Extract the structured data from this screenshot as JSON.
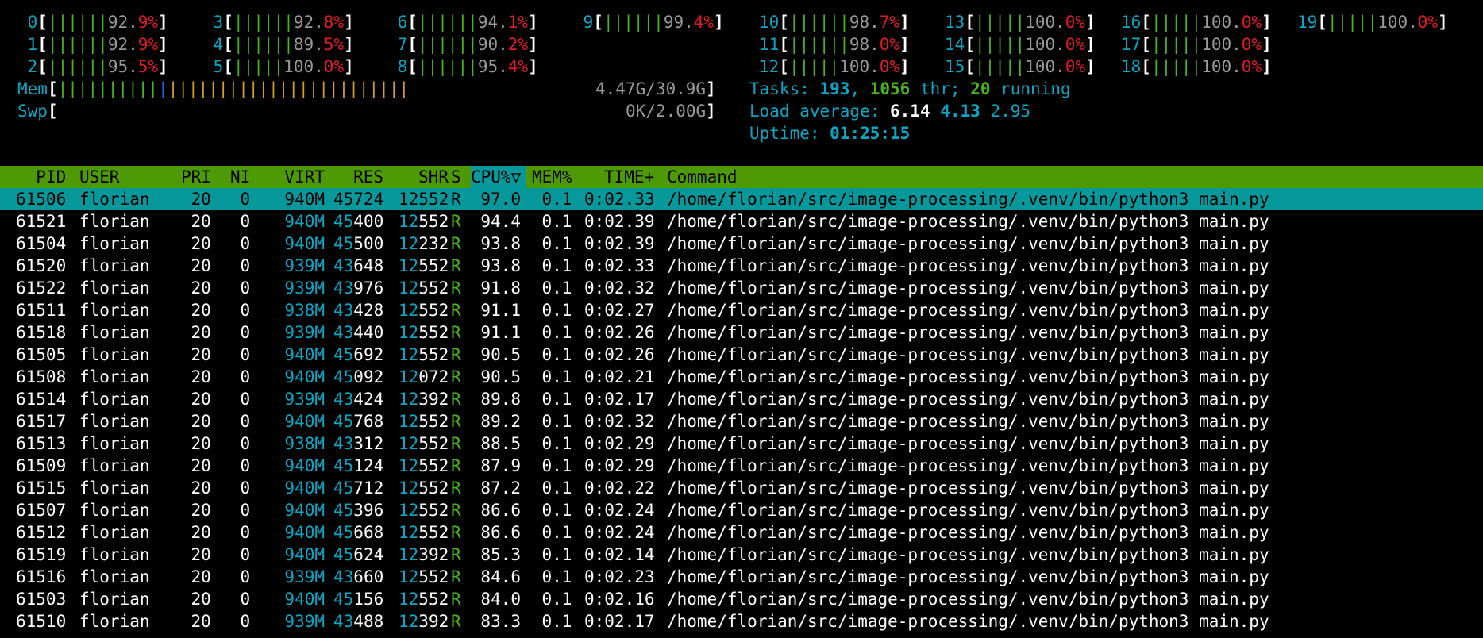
{
  "cpus": [
    {
      "id": "0",
      "bar": "||||||",
      "pct": "92.9",
      "col": 0,
      "row": 0
    },
    {
      "id": "1",
      "bar": "||||||",
      "pct": "92.9",
      "col": 0,
      "row": 1
    },
    {
      "id": "2",
      "bar": "||||||",
      "pct": "95.5",
      "col": 0,
      "row": 2
    },
    {
      "id": "3",
      "bar": "||||||",
      "pct": "92.8",
      "col": 1,
      "row": 0
    },
    {
      "id": "4",
      "bar": "||||||",
      "pct": "89.5",
      "col": 1,
      "row": 1
    },
    {
      "id": "5",
      "bar": "|||||",
      "pct": "100.0",
      "col": 1,
      "row": 2
    },
    {
      "id": "6",
      "bar": "||||||",
      "pct": "94.1",
      "col": 2,
      "row": 0
    },
    {
      "id": "7",
      "bar": "||||||",
      "pct": "90.2",
      "col": 2,
      "row": 1
    },
    {
      "id": "8",
      "bar": "||||||",
      "pct": "95.4",
      "col": 2,
      "row": 2
    },
    {
      "id": "9",
      "bar": "||||||",
      "pct": "99.4",
      "col": 3,
      "row": 0
    },
    {
      "id": "10",
      "bar": "||||||",
      "pct": "98.7",
      "col": 4,
      "row": 0
    },
    {
      "id": "11",
      "bar": "||||||",
      "pct": "98.0",
      "col": 4,
      "row": 1
    },
    {
      "id": "12",
      "bar": "|||||",
      "pct": "100.0",
      "col": 4,
      "row": 2
    },
    {
      "id": "13",
      "bar": "|||||",
      "pct": "100.0",
      "col": 5,
      "row": 0
    },
    {
      "id": "14",
      "bar": "|||||",
      "pct": "100.0",
      "col": 5,
      "row": 1
    },
    {
      "id": "15",
      "bar": "|||||",
      "pct": "100.0",
      "col": 5,
      "row": 2
    },
    {
      "id": "16",
      "bar": "|||||",
      "pct": "100.0",
      "col": 6,
      "row": 0
    },
    {
      "id": "17",
      "bar": "|||||",
      "pct": "100.0",
      "col": 6,
      "row": 1
    },
    {
      "id": "18",
      "bar": "|||||",
      "pct": "100.0",
      "col": 6,
      "row": 2
    },
    {
      "id": "19",
      "bar": "|||||",
      "pct": "100.0",
      "col": 7,
      "row": 0
    }
  ],
  "mem": {
    "label": "Mem",
    "bar_green": "||||||||||",
    "bar_blue": "|",
    "bar_orange": "||||||||||||||||||||||||",
    "value": "4.47G/30.9G"
  },
  "swp": {
    "label": "Swp",
    "value": "0K/2.00G"
  },
  "tasks": {
    "label": "Tasks: ",
    "count": "193",
    "threads": "1056",
    "thr_label": " thr; ",
    "running": "20",
    "running_label": " running"
  },
  "load": {
    "label": "Load average: ",
    "one": "6.14",
    "five": "4.13",
    "fifteen": "2.95"
  },
  "uptime": {
    "label": "Uptime: ",
    "value": "01:25:15"
  },
  "header": {
    "pid": "  PID",
    "user": "USER",
    "pri": "PRI",
    "ni": "NI",
    "virt": "VIRT",
    "res": "RES",
    "shr": "SHR",
    "s": "S",
    "cpu": "CPU%▽",
    "mem": "MEM%",
    "time": "TIME+",
    "command": "Command"
  },
  "colors": {
    "header_bg": "#4e9a06",
    "selected_bg": "#06989a",
    "cyan": "#0aa6c4",
    "green": "#4bb321",
    "red": "#e01b24"
  },
  "processes": [
    {
      "pid": "61506",
      "user": "florian",
      "pri": "20",
      "ni": "0",
      "virt": "940M",
      "res": "45724",
      "shr": "12552",
      "s": "R",
      "cpu": "97.0",
      "mem": "0.1",
      "time": "0:02.33",
      "cmd": "/home/florian/src/image-processing/.venv/bin/python3 main.py"
    },
    {
      "pid": "61521",
      "user": "florian",
      "pri": "20",
      "ni": "0",
      "virt": "940M",
      "res": "45400",
      "shr": "12552",
      "s": "R",
      "cpu": "94.4",
      "mem": "0.1",
      "time": "0:02.39",
      "cmd": "/home/florian/src/image-processing/.venv/bin/python3 main.py"
    },
    {
      "pid": "61504",
      "user": "florian",
      "pri": "20",
      "ni": "0",
      "virt": "940M",
      "res": "45500",
      "shr": "12232",
      "s": "R",
      "cpu": "93.8",
      "mem": "0.1",
      "time": "0:02.39",
      "cmd": "/home/florian/src/image-processing/.venv/bin/python3 main.py"
    },
    {
      "pid": "61520",
      "user": "florian",
      "pri": "20",
      "ni": "0",
      "virt": "939M",
      "res": "43648",
      "shr": "12552",
      "s": "R",
      "cpu": "93.8",
      "mem": "0.1",
      "time": "0:02.33",
      "cmd": "/home/florian/src/image-processing/.venv/bin/python3 main.py"
    },
    {
      "pid": "61522",
      "user": "florian",
      "pri": "20",
      "ni": "0",
      "virt": "939M",
      "res": "43976",
      "shr": "12552",
      "s": "R",
      "cpu": "91.8",
      "mem": "0.1",
      "time": "0:02.32",
      "cmd": "/home/florian/src/image-processing/.venv/bin/python3 main.py"
    },
    {
      "pid": "61511",
      "user": "florian",
      "pri": "20",
      "ni": "0",
      "virt": "938M",
      "res": "43428",
      "shr": "12552",
      "s": "R",
      "cpu": "91.1",
      "mem": "0.1",
      "time": "0:02.27",
      "cmd": "/home/florian/src/image-processing/.venv/bin/python3 main.py"
    },
    {
      "pid": "61518",
      "user": "florian",
      "pri": "20",
      "ni": "0",
      "virt": "939M",
      "res": "43440",
      "shr": "12552",
      "s": "R",
      "cpu": "91.1",
      "mem": "0.1",
      "time": "0:02.26",
      "cmd": "/home/florian/src/image-processing/.venv/bin/python3 main.py"
    },
    {
      "pid": "61505",
      "user": "florian",
      "pri": "20",
      "ni": "0",
      "virt": "940M",
      "res": "45692",
      "shr": "12552",
      "s": "R",
      "cpu": "90.5",
      "mem": "0.1",
      "time": "0:02.26",
      "cmd": "/home/florian/src/image-processing/.venv/bin/python3 main.py"
    },
    {
      "pid": "61508",
      "user": "florian",
      "pri": "20",
      "ni": "0",
      "virt": "940M",
      "res": "45092",
      "shr": "12072",
      "s": "R",
      "cpu": "90.5",
      "mem": "0.1",
      "time": "0:02.21",
      "cmd": "/home/florian/src/image-processing/.venv/bin/python3 main.py"
    },
    {
      "pid": "61514",
      "user": "florian",
      "pri": "20",
      "ni": "0",
      "virt": "939M",
      "res": "43424",
      "shr": "12392",
      "s": "R",
      "cpu": "89.8",
      "mem": "0.1",
      "time": "0:02.17",
      "cmd": "/home/florian/src/image-processing/.venv/bin/python3 main.py"
    },
    {
      "pid": "61517",
      "user": "florian",
      "pri": "20",
      "ni": "0",
      "virt": "940M",
      "res": "45768",
      "shr": "12552",
      "s": "R",
      "cpu": "89.2",
      "mem": "0.1",
      "time": "0:02.32",
      "cmd": "/home/florian/src/image-processing/.venv/bin/python3 main.py"
    },
    {
      "pid": "61513",
      "user": "florian",
      "pri": "20",
      "ni": "0",
      "virt": "938M",
      "res": "43312",
      "shr": "12552",
      "s": "R",
      "cpu": "88.5",
      "mem": "0.1",
      "time": "0:02.29",
      "cmd": "/home/florian/src/image-processing/.venv/bin/python3 main.py"
    },
    {
      "pid": "61509",
      "user": "florian",
      "pri": "20",
      "ni": "0",
      "virt": "940M",
      "res": "45124",
      "shr": "12552",
      "s": "R",
      "cpu": "87.9",
      "mem": "0.1",
      "time": "0:02.29",
      "cmd": "/home/florian/src/image-processing/.venv/bin/python3 main.py"
    },
    {
      "pid": "61515",
      "user": "florian",
      "pri": "20",
      "ni": "0",
      "virt": "940M",
      "res": "45712",
      "shr": "12552",
      "s": "R",
      "cpu": "87.2",
      "mem": "0.1",
      "time": "0:02.22",
      "cmd": "/home/florian/src/image-processing/.venv/bin/python3 main.py"
    },
    {
      "pid": "61507",
      "user": "florian",
      "pri": "20",
      "ni": "0",
      "virt": "940M",
      "res": "45396",
      "shr": "12552",
      "s": "R",
      "cpu": "86.6",
      "mem": "0.1",
      "time": "0:02.24",
      "cmd": "/home/florian/src/image-processing/.venv/bin/python3 main.py"
    },
    {
      "pid": "61512",
      "user": "florian",
      "pri": "20",
      "ni": "0",
      "virt": "940M",
      "res": "45668",
      "shr": "12552",
      "s": "R",
      "cpu": "86.6",
      "mem": "0.1",
      "time": "0:02.24",
      "cmd": "/home/florian/src/image-processing/.venv/bin/python3 main.py"
    },
    {
      "pid": "61519",
      "user": "florian",
      "pri": "20",
      "ni": "0",
      "virt": "940M",
      "res": "45624",
      "shr": "12392",
      "s": "R",
      "cpu": "85.3",
      "mem": "0.1",
      "time": "0:02.14",
      "cmd": "/home/florian/src/image-processing/.venv/bin/python3 main.py"
    },
    {
      "pid": "61516",
      "user": "florian",
      "pri": "20",
      "ni": "0",
      "virt": "939M",
      "res": "43660",
      "shr": "12552",
      "s": "R",
      "cpu": "84.6",
      "mem": "0.1",
      "time": "0:02.23",
      "cmd": "/home/florian/src/image-processing/.venv/bin/python3 main.py"
    },
    {
      "pid": "61503",
      "user": "florian",
      "pri": "20",
      "ni": "0",
      "virt": "940M",
      "res": "45156",
      "shr": "12552",
      "s": "R",
      "cpu": "84.0",
      "mem": "0.1",
      "time": "0:02.16",
      "cmd": "/home/florian/src/image-processing/.venv/bin/python3 main.py"
    },
    {
      "pid": "61510",
      "user": "florian",
      "pri": "20",
      "ni": "0",
      "virt": "939M",
      "res": "43488",
      "shr": "12392",
      "s": "R",
      "cpu": "83.3",
      "mem": "0.1",
      "time": "0:02.17",
      "cmd": "/home/florian/src/image-processing/.venv/bin/python3 main.py"
    }
  ]
}
